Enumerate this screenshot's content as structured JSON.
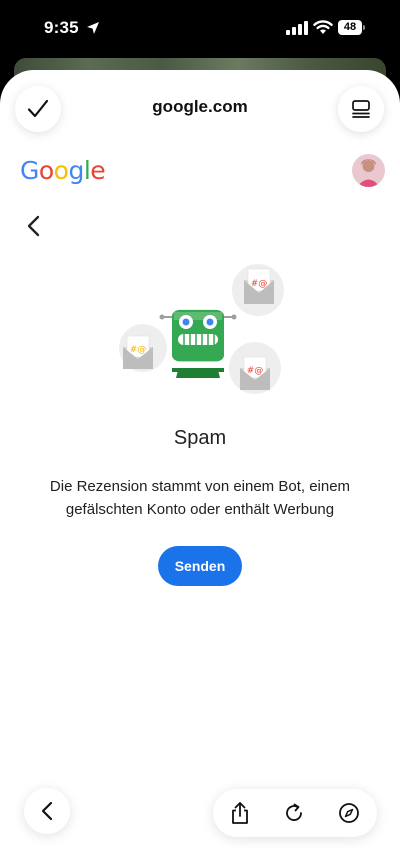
{
  "status_bar": {
    "time": "9:35",
    "battery": "48"
  },
  "browser": {
    "url": "google.com"
  },
  "page": {
    "logo_letters": [
      "G",
      "o",
      "o",
      "g",
      "l",
      "e"
    ],
    "logo_colors": [
      "#4285F4",
      "#EA4335",
      "#FBBC05",
      "#4285F4",
      "#34A853",
      "#EA4335"
    ],
    "title": "Spam",
    "description": "Die Rezension stammt von einem Bot, einem gefälschten Konto oder enthält Werbung",
    "send_label": "Senden",
    "accent": "#1a73e8"
  },
  "icons": {
    "done": "checkmark-icon",
    "tabs": "tabs-icon",
    "back": "chevron-left-icon",
    "share": "share-icon",
    "reload": "reload-icon",
    "compass": "compass-icon"
  }
}
